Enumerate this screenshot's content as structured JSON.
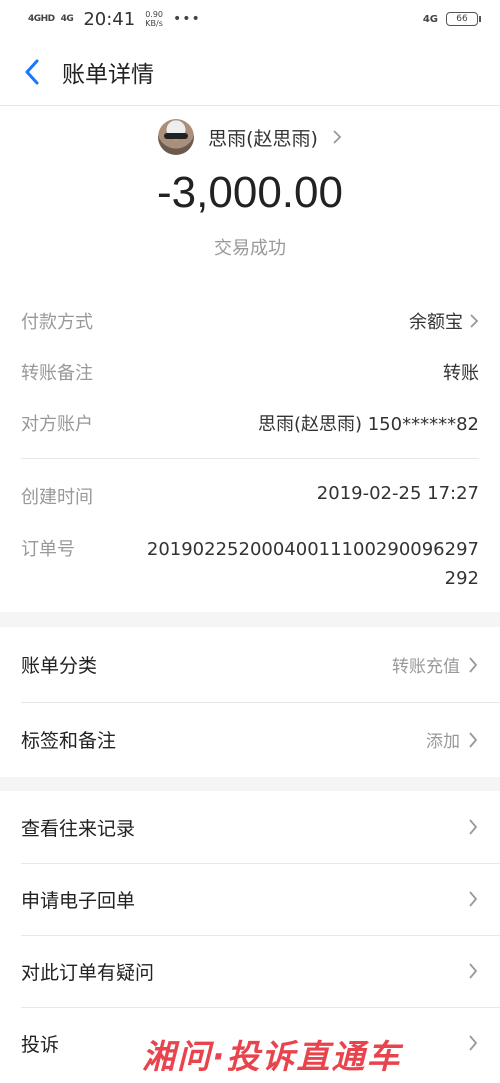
{
  "status_bar": {
    "signal1": "4GHD",
    "signal2": "4G",
    "time": "20:41",
    "speed": "0.90",
    "speed_unit": "KB/s",
    "dots": "•••",
    "net": "4G",
    "battery": "66"
  },
  "nav": {
    "title": "账单详情"
  },
  "payee": {
    "name": "思雨(赵思雨)"
  },
  "amount": "-3,000.00",
  "tx_status": "交易成功",
  "details": [
    {
      "label": "付款方式",
      "value": "余额宝"
    },
    {
      "label": "转账备注",
      "value": "转账"
    },
    {
      "label": "对方账户",
      "value": "思雨(赵思雨) 150******82"
    }
  ],
  "details2": {
    "created_label": "创建时间",
    "created_value": "2019-02-25 17:27",
    "order_label": "订单号",
    "order_value_line1": "20190225200040011100290096297",
    "order_value_line2": "292"
  },
  "menu1": [
    {
      "label": "账单分类",
      "value": "转账充值"
    },
    {
      "label": "标签和备注",
      "value": "添加"
    }
  ],
  "menu2": [
    {
      "label": "查看往来记录"
    },
    {
      "label": "申请电子回单"
    },
    {
      "label": "对此订单有疑问"
    },
    {
      "label": "投诉"
    }
  ],
  "watermark": "湘问·投诉直通车"
}
